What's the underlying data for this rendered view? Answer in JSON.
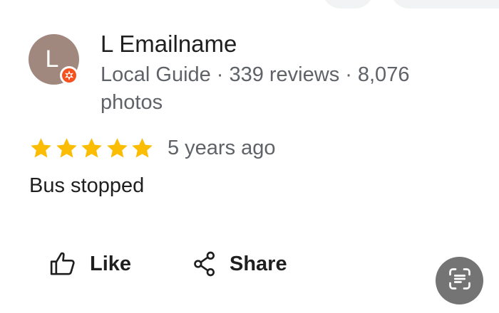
{
  "reviewer": {
    "avatar_letter": "L",
    "avatar_color": "#a1887f",
    "name": "L Emailname",
    "level": "Local Guide",
    "separator": "·",
    "reviews": "339 reviews",
    "photos": "8,076 photos",
    "badge_icon": "local-guide-badge-icon"
  },
  "review": {
    "rating": 5,
    "max_rating": 5,
    "star_color": "#fbbc04",
    "time_ago": "5 years ago",
    "text": "Bus stopped"
  },
  "actions": {
    "like_label": "Like",
    "share_label": "Share",
    "like_icon": "thumbs-up-icon",
    "share_icon": "share-icon"
  },
  "floating": {
    "icon": "text-scan-icon"
  }
}
